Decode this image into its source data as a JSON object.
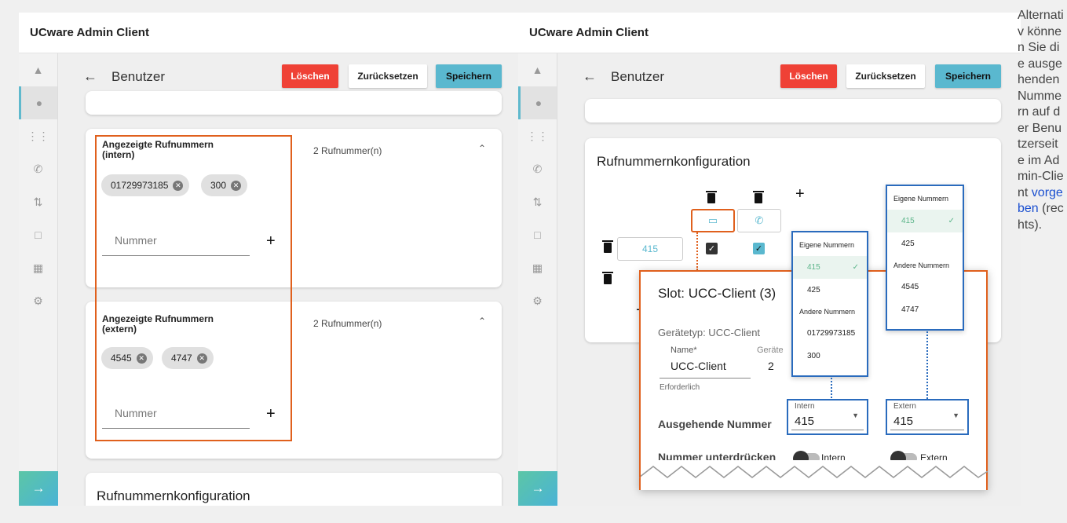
{
  "app_title": "UCware Admin Client",
  "page_title": "Benutzer",
  "buttons": {
    "delete": "Löschen",
    "reset": "Zurücksetzen",
    "save": "Speichern"
  },
  "card_intern": {
    "title_line1": "Angezeigte Rufnummern",
    "title_line2": "(intern)",
    "count": "2 Rufnummer(n)",
    "chips": [
      "01729973185",
      "300"
    ],
    "placeholder": "Nummer"
  },
  "card_extern": {
    "title_line1": "Angezeigte Rufnummern",
    "title_line2": "(extern)",
    "count": "2 Rufnummer(n)",
    "chips": [
      "4545",
      "4747"
    ],
    "placeholder": "Nummer"
  },
  "card_config": {
    "title": "Rufnummernkonfiguration"
  },
  "config": {
    "row_number": "415"
  },
  "dropdown_intern": {
    "header_own": "Eigene Nummern",
    "own": [
      "415",
      "425"
    ],
    "header_other": "Andere Nummern",
    "other": [
      "01729973185",
      "300"
    ]
  },
  "dropdown_extern": {
    "header_own": "Eigene Nummern",
    "own": [
      "415",
      "425"
    ],
    "header_other": "Andere Nummern",
    "other": [
      "4545",
      "4747"
    ]
  },
  "slot": {
    "title": "Slot: UCC-Client (3)",
    "device_type": "Gerätetyp: UCC-Client",
    "name_label": "Name*",
    "name_value": "UCC-Client",
    "device_label": "Geräte",
    "device_value": "2",
    "required": "Erforderlich",
    "outgoing_label": "Ausgehende Nummer",
    "intern_label": "Intern",
    "intern_value": "415",
    "extern_label": "Extern",
    "extern_value": "415",
    "suppress_label": "Nummer unterdrücken",
    "toggle_intern": "Intern",
    "toggle_extern": "Extern"
  },
  "note": {
    "text_before": "Alternativ können Sie die ausgehenden Nummern auf der Benutzerseite im Admin-Client",
    "link": "vorgeben",
    "text_after": "(rechts)."
  },
  "colors": {
    "delete": "#ef4136",
    "save": "#5ab8cf",
    "highlight_orange": "#e0601d",
    "highlight_blue": "#2a6bbd"
  }
}
